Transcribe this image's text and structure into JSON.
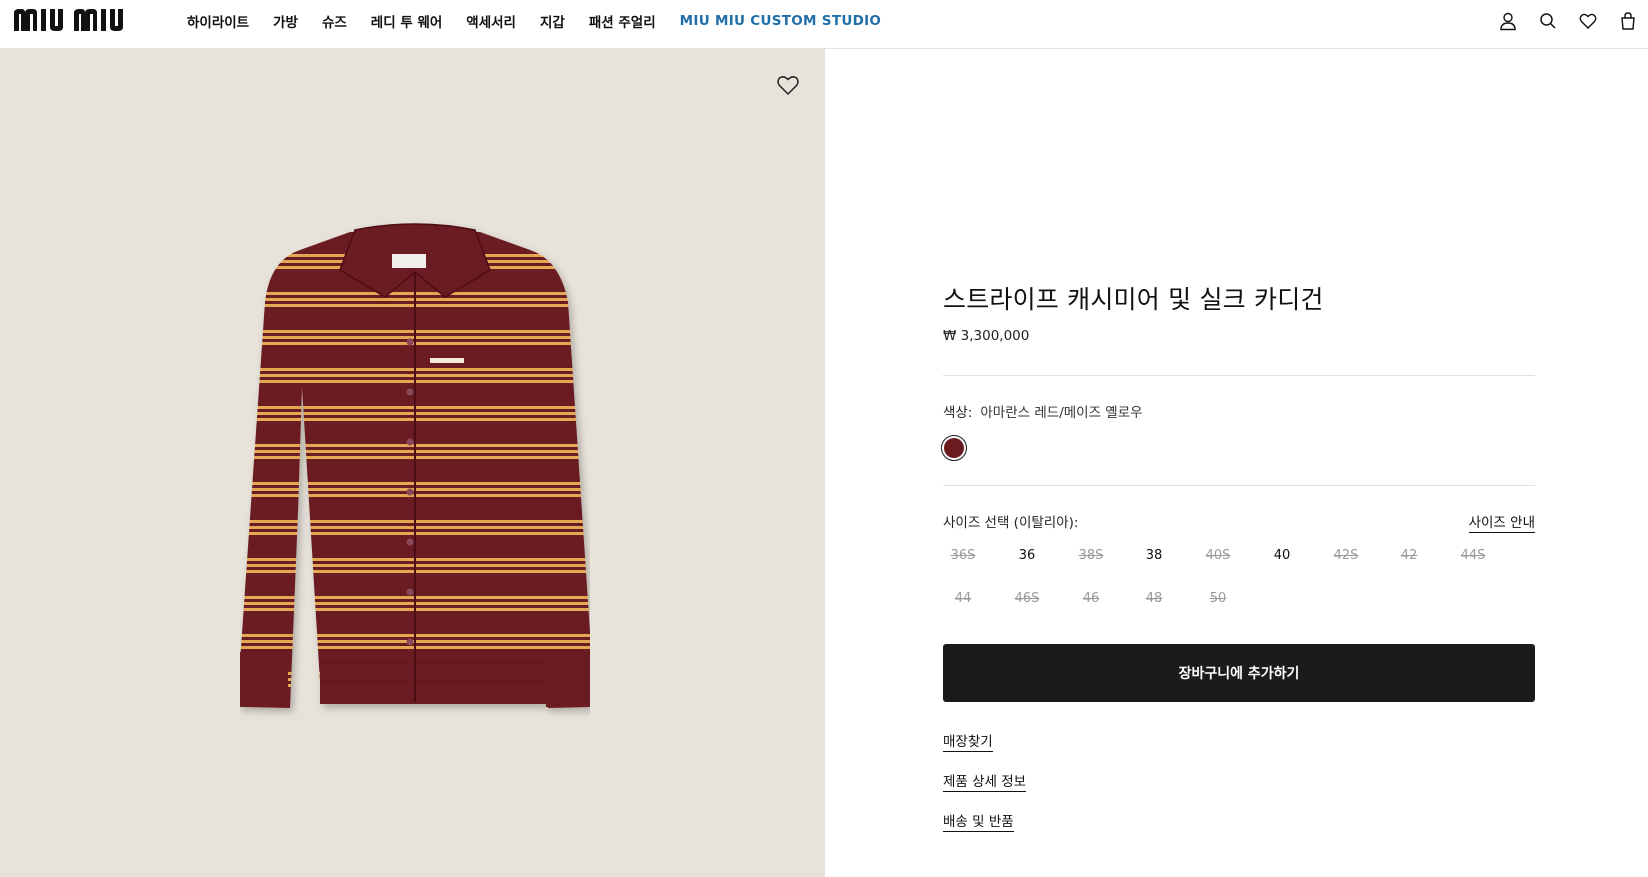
{
  "header": {
    "logo_text": "miu miu",
    "nav": [
      {
        "label": "하이라이트"
      },
      {
        "label": "가방"
      },
      {
        "label": "슈즈"
      },
      {
        "label": "레디 투 웨어"
      },
      {
        "label": "액세서리"
      },
      {
        "label": "지갑"
      },
      {
        "label": "패션 주얼리"
      },
      {
        "label": "MIU MIU CUSTOM STUDIO",
        "accent": "#1f6ea8"
      }
    ],
    "icons": [
      "user-icon",
      "search-icon",
      "heart-icon",
      "bag-icon"
    ]
  },
  "product": {
    "image_background": "#e8e3da",
    "title": "스트라이프 캐시미어 및 실크 카디건",
    "price": "₩ 3,300,000",
    "color_label": "색상:",
    "color_value": "아마란스 레드/메이즈 옐로우",
    "swatch_color": "#6b1a20",
    "size_label": "사이즈 선택 (이탈리아):",
    "size_guide": "사이즈 안내",
    "sizes": [
      {
        "label": "36S",
        "available": false
      },
      {
        "label": "36",
        "available": true
      },
      {
        "label": "38S",
        "available": false
      },
      {
        "label": "38",
        "available": true
      },
      {
        "label": "40S",
        "available": false
      },
      {
        "label": "40",
        "available": true
      },
      {
        "label": "42S",
        "available": false
      },
      {
        "label": "42",
        "available": false
      },
      {
        "label": "44S",
        "available": false
      },
      {
        "label": "44",
        "available": false
      },
      {
        "label": "46S",
        "available": false
      },
      {
        "label": "46",
        "available": false
      },
      {
        "label": "48",
        "available": false
      },
      {
        "label": "50",
        "available": false
      }
    ],
    "add_to_cart": "장바구니에 추가하기",
    "links": [
      "매장찾기",
      "제품 상세 정보",
      "배송 및 반품"
    ]
  }
}
